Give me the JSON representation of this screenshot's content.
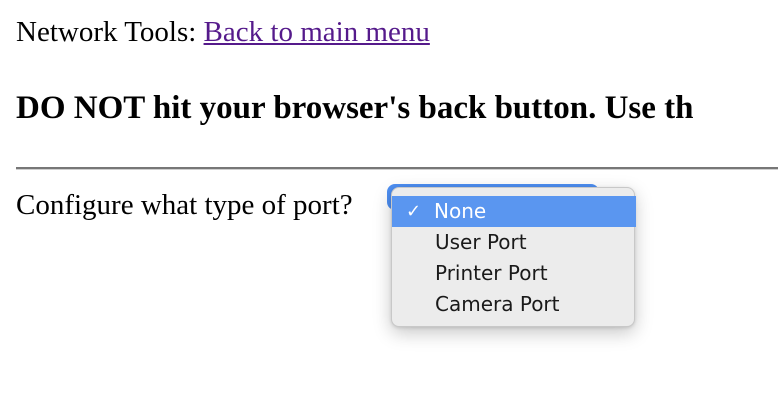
{
  "header": {
    "prefix": "Network Tools: ",
    "link_label": "Back to main menu"
  },
  "warning": "DO NOT hit your browser's back button. Use th",
  "form": {
    "question": "Configure what type of port?",
    "dropdown": {
      "check_glyph": "✓",
      "options": [
        {
          "label": "None",
          "selected": true
        },
        {
          "label": "User Port",
          "selected": false
        },
        {
          "label": "Printer Port",
          "selected": false
        },
        {
          "label": "Camera Port",
          "selected": false
        }
      ]
    }
  },
  "colors": {
    "link": "#551a8b",
    "selection": "#5a96f0",
    "menu_bg": "#ececec"
  }
}
